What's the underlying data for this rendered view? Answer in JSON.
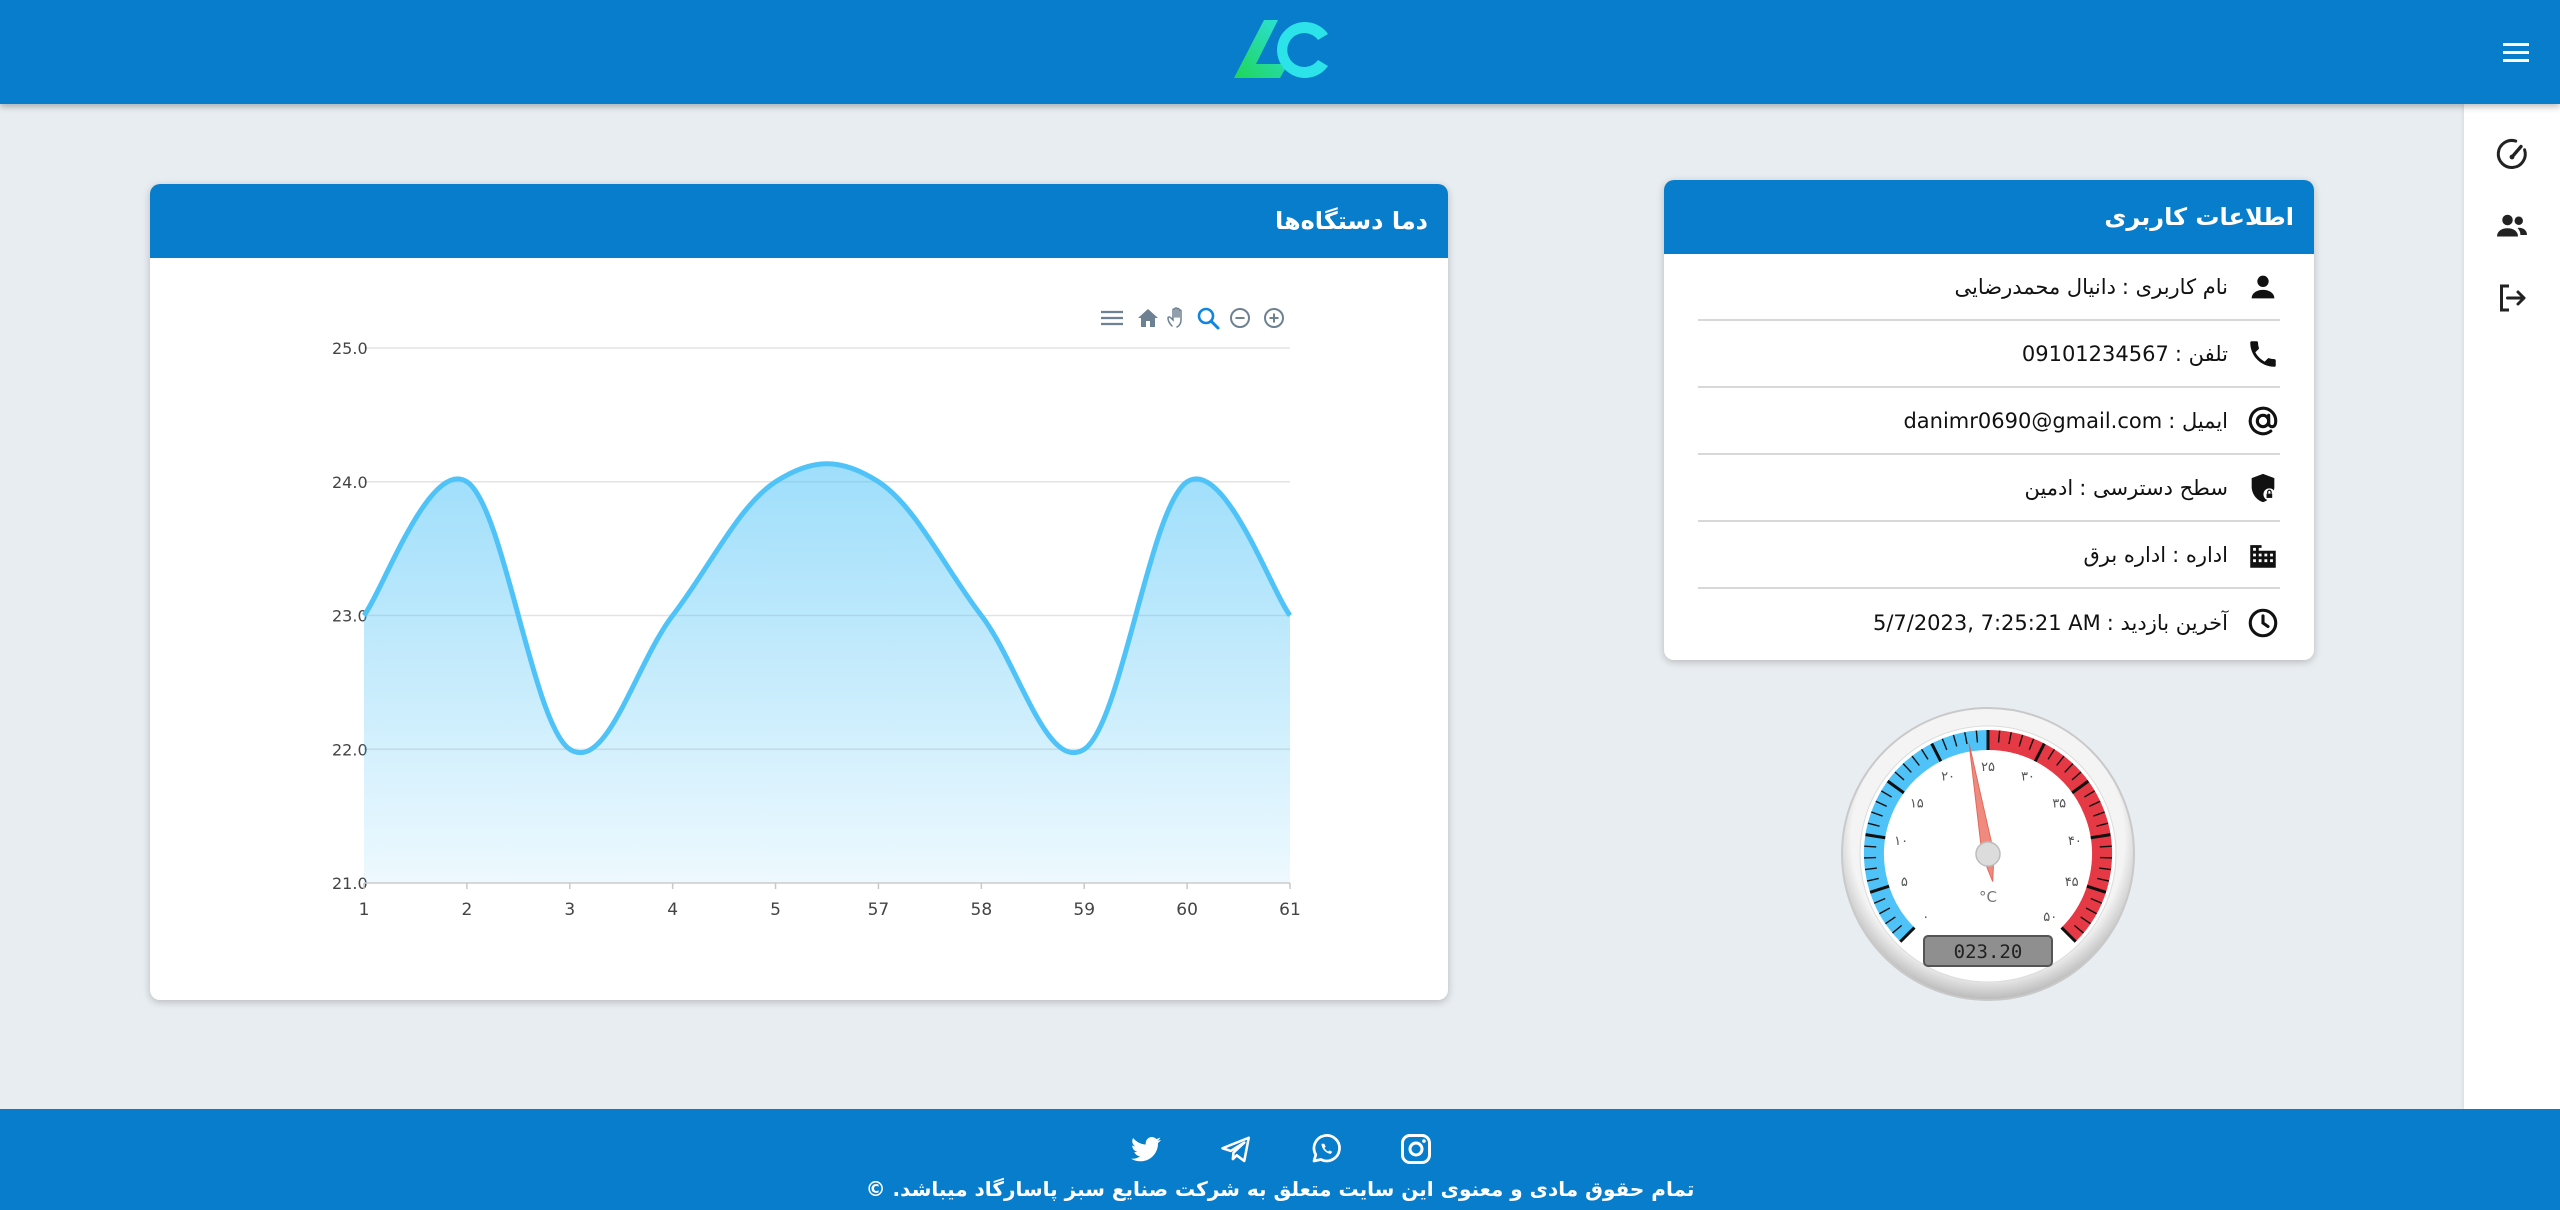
{
  "header": {
    "logo_icon": "ac-logo-icon",
    "menu_icon": "hamburger-menu-icon"
  },
  "sidebar": {
    "items": [
      {
        "icon": "speedometer-icon"
      },
      {
        "icon": "users-icon"
      },
      {
        "icon": "logout-icon"
      }
    ]
  },
  "info_card": {
    "title": "اطلاعات کاربری",
    "rows": [
      {
        "icon": "person-icon",
        "label": "نام کاربری :",
        "value": "دانیال محمدرضایی"
      },
      {
        "icon": "phone-icon",
        "label": "تلفن :",
        "value": "09101234567"
      },
      {
        "icon": "at-sign-icon",
        "label": "ایمیل :",
        "value": "danimr0690@gmail.com"
      },
      {
        "icon": "shield-lock-icon",
        "label": "سطح دسترسی :",
        "value": "ادمین"
      },
      {
        "icon": "building-icon",
        "label": "اداره :",
        "value": "اداره برق"
      },
      {
        "icon": "clock-icon",
        "label": "آخرین بازدید :",
        "value": "5/7/2023, 7:25:21 AM"
      }
    ]
  },
  "chart_card": {
    "title": "دما دستگاه‌ها",
    "toolbar": [
      "zoom-in-icon",
      "zoom-out-icon",
      "zoom-selection-icon",
      "pan-hand-icon",
      "home-reset-icon",
      "chart-menu-icon"
    ]
  },
  "chart_data": {
    "type": "area",
    "categories": [
      "1",
      "2",
      "3",
      "4",
      "5",
      "57",
      "58",
      "59",
      "60",
      "61"
    ],
    "series": [
      {
        "values": [
          23,
          24,
          22,
          23,
          24,
          24,
          23,
          22,
          24,
          23
        ]
      }
    ],
    "y_ticks": [
      "21.0",
      "22.0",
      "23.0",
      "24.0",
      "25.0"
    ],
    "ylim": [
      21,
      25
    ],
    "grid": true,
    "color": "#4fc3f7"
  },
  "gauge": {
    "value": 23.2,
    "value_text": "023.20",
    "unit": "°C",
    "min": 0,
    "max": 50,
    "tick_labels": [
      "۰",
      "۵",
      "۱۰",
      "۱۵",
      "۲۰",
      "۲۵",
      "۳۰",
      "۳۵",
      "۴۰",
      "۴۵",
      "۵۰"
    ],
    "cold_color": "#4fc3f7",
    "hot_color": "#e53945"
  },
  "footer": {
    "social": [
      "instagram-icon",
      "whatsapp-icon",
      "telegram-icon",
      "twitter-icon"
    ],
    "copyright": "تمام حقوق مادی و معنوی این سایت متعلق به شرکت صنایع سبز پاسارگاد میباشد. ©"
  },
  "colors": {
    "primary": "#087dcb",
    "background": "#e8edf1"
  }
}
